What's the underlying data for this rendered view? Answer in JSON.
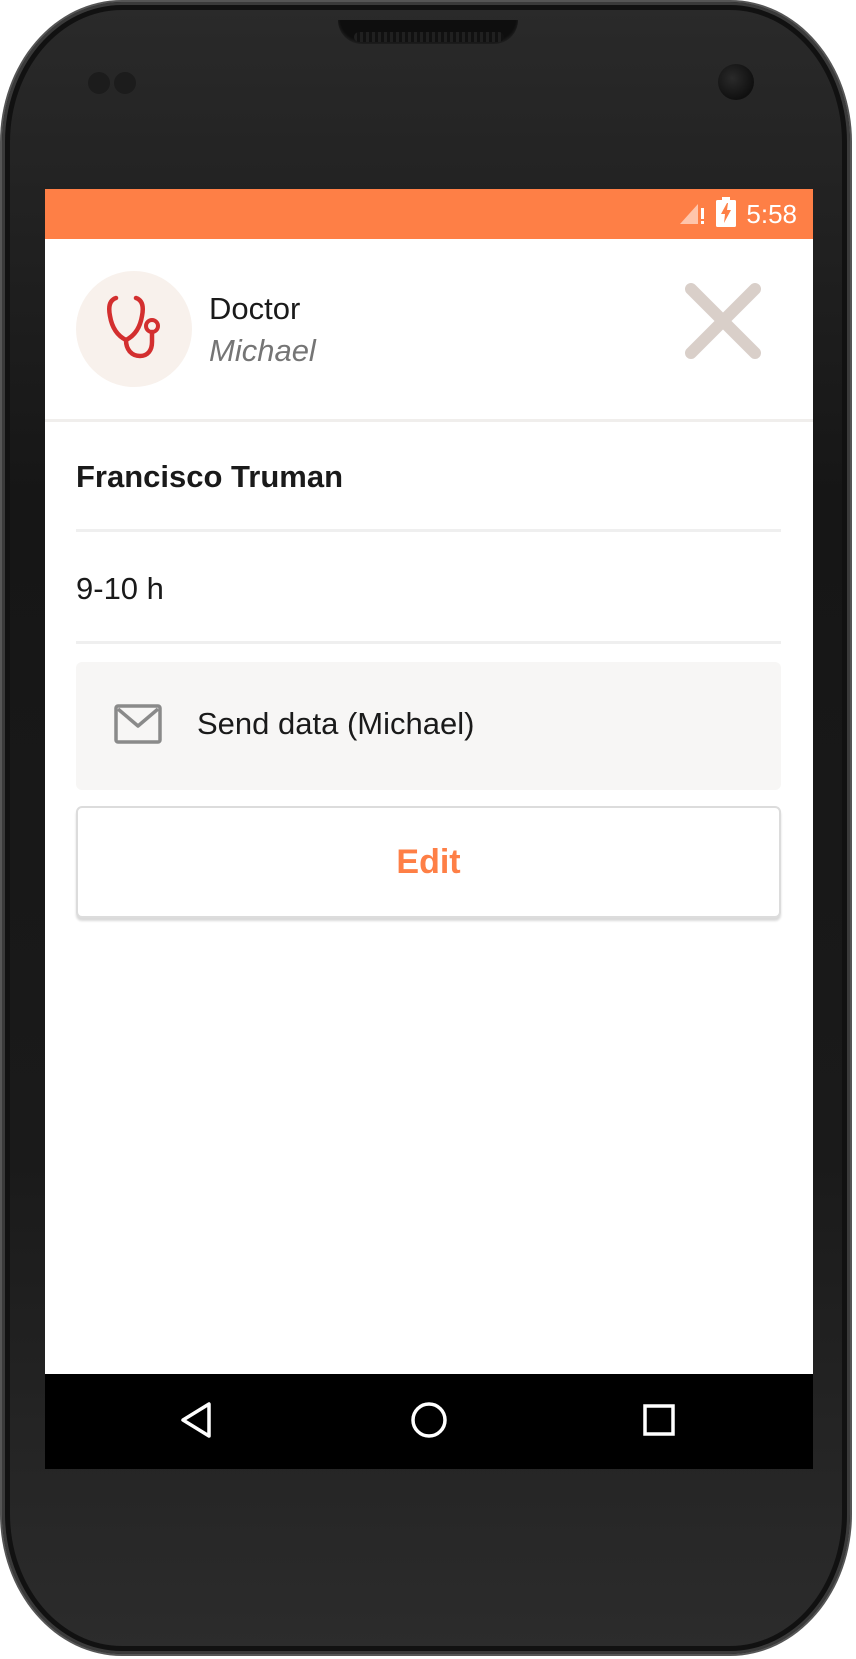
{
  "status_bar": {
    "time": "5:58",
    "icons": [
      "signal-icon",
      "battery-charging-icon"
    ],
    "color": "#fe7f46"
  },
  "header": {
    "role": "Doctor",
    "name": "Michael",
    "avatar_icon": "stethoscope-icon",
    "close_icon": "close-icon"
  },
  "appointment": {
    "patient_name": "Francisco Truman",
    "time_slot": "9-10 h"
  },
  "actions": {
    "send_label": "Send data (Michael)",
    "send_icon": "envelope-icon",
    "edit_label": "Edit"
  },
  "nav_bar": {
    "icons": [
      "back-icon",
      "home-icon",
      "recents-icon"
    ]
  },
  "colors": {
    "accent": "#fe7f46",
    "stethoscope": "#d32f2f",
    "close": "#d9cfc9"
  }
}
